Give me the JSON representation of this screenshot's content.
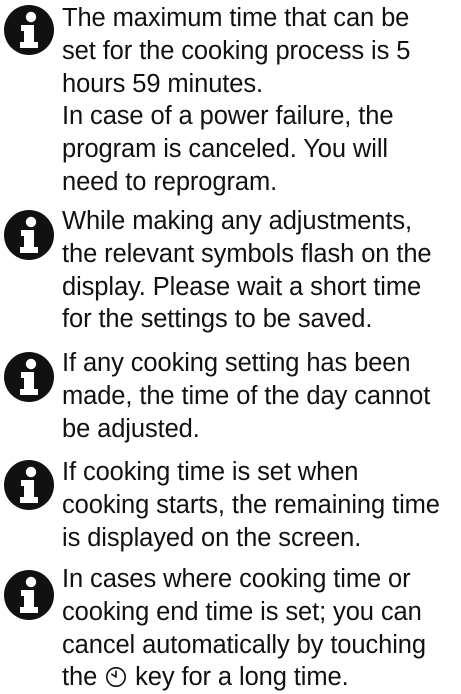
{
  "icon": "info-icon",
  "notes": [
    {
      "text": "The maximum time that can be\nset for the cooking process is 5\nhours 59 minutes.\nIn case of a power failure, the\nprogram is canceled. You will\nneed to reprogram."
    },
    {
      "text": "While making any adjustments,\nthe relevant symbols flash on the\ndisplay. Please wait a short time\nfor the settings to be saved."
    },
    {
      "text": "If any cooking setting has been\nmade, the time of the day cannot\nbe adjusted."
    },
    {
      "text": "If cooking time is set when\ncooking starts, the remaining time\nis displayed on the screen."
    },
    {
      "text_before_icon": "In cases where cooking time or\ncooking end time is set; you can\ncancel automatically by touching\nthe ",
      "inline_icon": "clock-icon",
      "text_after_icon": " key for a long time."
    }
  ]
}
